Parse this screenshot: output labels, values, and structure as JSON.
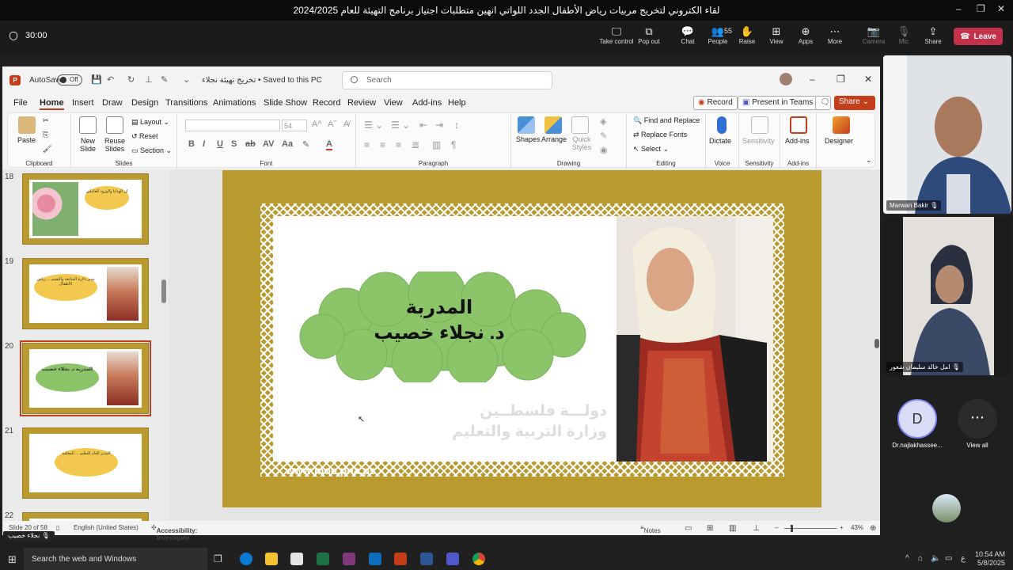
{
  "window": {
    "title": "لقاء الكتروني لتخريج مربيات رياض الأطفال الجدد اللواتي انهين متطلبات اجتياز برنامج التهيئة للعام 2024/2025",
    "minimize": "–",
    "restore": "❐",
    "close": "✕"
  },
  "meeting": {
    "timer": "30:00",
    "toolbar": [
      {
        "label": "Take control",
        "icon": "take-control-icon",
        "glyph": "🖵",
        "disabled": false
      },
      {
        "label": "Pop out",
        "icon": "pop-out-icon",
        "glyph": "⧉",
        "disabled": false
      },
      {
        "label": "Chat",
        "icon": "chat-icon",
        "glyph": "💬",
        "disabled": false
      },
      {
        "label": "People",
        "icon": "people-icon",
        "glyph": "👥",
        "count": "55",
        "disabled": false
      },
      {
        "label": "Raise",
        "icon": "raise-hand-icon",
        "glyph": "✋",
        "disabled": false
      },
      {
        "label": "View",
        "icon": "view-grid-icon",
        "glyph": "⊞",
        "disabled": false
      },
      {
        "label": "Apps",
        "icon": "apps-icon",
        "glyph": "⊕",
        "disabled": false
      },
      {
        "label": "More",
        "icon": "more-icon",
        "glyph": "⋯",
        "disabled": false
      },
      {
        "label": "Camera",
        "icon": "camera-off-icon",
        "glyph": "📷",
        "disabled": true
      },
      {
        "label": "Mic",
        "icon": "mic-off-icon",
        "glyph": "🎙",
        "disabled": true
      },
      {
        "label": "Share",
        "icon": "share-icon",
        "glyph": "⇪",
        "disabled": false
      }
    ],
    "leave_label": "Leave"
  },
  "ppt": {
    "autosave_label": "AutoSave",
    "autosave_state": "Off",
    "doc_name": "تخريج تهيئة نجلاء • Saved to this PC",
    "search_placeholder": "Search",
    "tabs": [
      "File",
      "Home",
      "Insert",
      "Draw",
      "Design",
      "Transitions",
      "Animations",
      "Slide Show",
      "Record",
      "Review",
      "View",
      "Add-ins",
      "Help"
    ],
    "active_tab": "Home",
    "record_label": "Record",
    "present_label": "Present in Teams",
    "share_label": "Share",
    "ribbon": {
      "clipboard": {
        "paste": "Paste",
        "label": "Clipboard"
      },
      "slides": {
        "new_slide": "New Slide",
        "reuse": "Reuse Slides",
        "layout": "Layout",
        "reset": "Reset",
        "section": "Section",
        "label": "Slides"
      },
      "font": {
        "size": "54",
        "label": "Font"
      },
      "paragraph": {
        "label": "Paragraph"
      },
      "drawing": {
        "shapes": "Shapes",
        "arrange": "Arrange",
        "quick_styles": "Quick Styles",
        "label": "Drawing"
      },
      "editing": {
        "find": "Find and Replace",
        "replace_fonts": "Replace Fonts",
        "select": "Select",
        "label": "Editing"
      },
      "voice": {
        "dictate": "Dictate",
        "label": "Voice"
      },
      "sensitivity": {
        "btn": "Sensitivity",
        "label": "Sensitivity"
      },
      "addins": {
        "btn": "Add-ins",
        "label": "Add-ins"
      },
      "designer": {
        "btn": "Designer"
      }
    },
    "thumbnails": [
      {
        "num": "18",
        "text": "ان الهدايا والورود للعاملين",
        "selected": false
      },
      {
        "num": "19",
        "text": "مدير دائرة المتابعة والتقييم ... رياض الأطفال",
        "selected": false
      },
      {
        "num": "20",
        "text": "المدربة د. نجلاء خصيب",
        "selected": true
      },
      {
        "num": "21",
        "text": "المدير العام للتعليم ... المعلمة",
        "selected": false
      },
      {
        "num": "22",
        "text": "",
        "selected": false
      }
    ],
    "slide": {
      "line1": "المدربة",
      "line2": "د. نجلاء خصيب",
      "wm_line1": "دولـــة فلسطــين",
      "wm_line2": "وزارة التربية والتعليم",
      "website": "www.moe.pna.ps"
    },
    "status": {
      "slide_count": "Slide 20 of 58",
      "language": "English (United States)",
      "accessibility": "Accessibility: Investigate",
      "notes": "Notes",
      "zoom": "43%"
    }
  },
  "participants": [
    {
      "name": "Marwan Bakir"
    },
    {
      "name": "امل خالد سليمان شعور"
    },
    {
      "name": "Dr.najlakhassee...",
      "initial": "D"
    },
    {
      "name": "View all"
    }
  ],
  "presenter_name": "نجلاء خصيب",
  "taskbar": {
    "search_placeholder": "Search the web and Windows",
    "time": "10:54 AM",
    "date": "5/8/2025",
    "lang": "ع"
  },
  "colors": {
    "accent": "#c43e1c",
    "slide_gold": "#b99a2f",
    "cloud_green": "#8cc46a",
    "leave_red": "#c4314b"
  }
}
